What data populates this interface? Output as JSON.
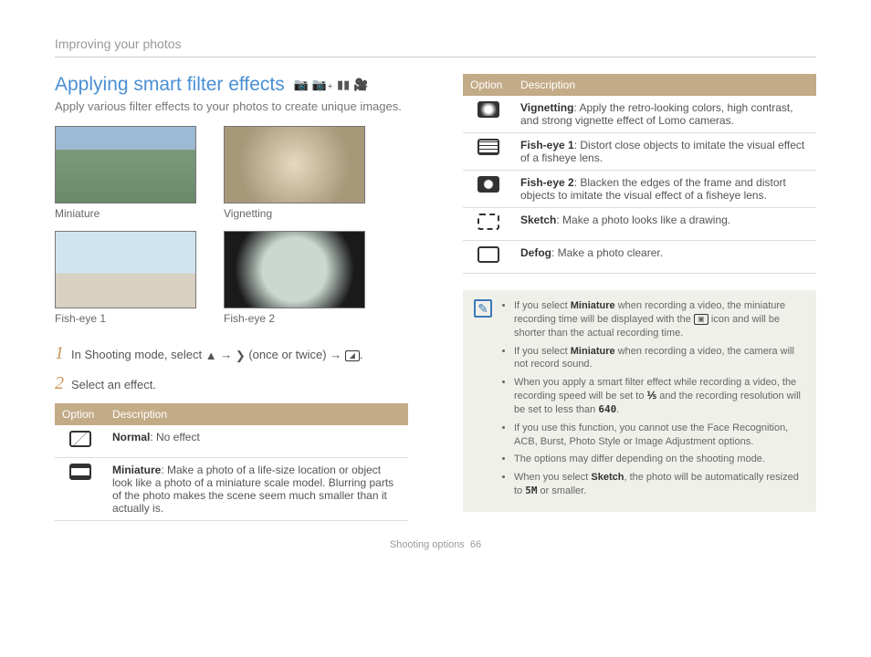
{
  "breadcrumb": "Improving your photos",
  "title": "Applying smart filter effects",
  "subtitle": "Apply various filter effects to your photos to create unique images.",
  "thumbs": {
    "t1": "Miniature",
    "t2": "Vignetting",
    "t3": "Fish-eye 1",
    "t4": "Fish-eye 2"
  },
  "steps": {
    "s1_prefix": "In Shooting mode, select ",
    "s1_mid": " (once or twice) → ",
    "s2": "Select an effect."
  },
  "table1": {
    "h1": "Option",
    "h2": "Description",
    "rows": {
      "r1_name": "Normal",
      "r1_desc": ": No effect",
      "r2_name": "Miniature",
      "r2_desc": ": Make a photo of a life-size location or object look like a photo of a miniature scale model. Blurring parts of the photo makes the scene seem much smaller than it actually is."
    }
  },
  "table2": {
    "h1": "Option",
    "h2": "Description",
    "rows": {
      "r1_name": "Vignetting",
      "r1_desc": ": Apply the retro-looking colors, high contrast, and strong vignette effect of Lomo cameras.",
      "r2_name": "Fish-eye 1",
      "r2_desc": ": Distort close objects to imitate the visual effect of a fisheye lens.",
      "r3_name": "Fish-eye 2",
      "r3_desc": ": Blacken the edges of the frame and distort objects to imitate the visual effect of a fisheye lens.",
      "r4_name": "Sketch",
      "r4_desc": ": Make a photo looks like a drawing.",
      "r5_name": "Defog",
      "r5_desc": ": Make a photo clearer."
    }
  },
  "notes": {
    "n1a": "If you select ",
    "n1b": "Miniature",
    "n1c": " when recording a video, the miniature recording time will be displayed with the ",
    "n1d": " icon and will be shorter than the actual recording time.",
    "n2a": "If you select ",
    "n2b": "Miniature",
    "n2c": " when recording a video, the camera will not record sound.",
    "n3a": "When you apply a smart filter effect while recording a video, the recording speed will be set to ",
    "n3b": " and the recording resolution will be set to less than ",
    "n3c": ".",
    "n3_speed": "⅕",
    "n3_res": "640",
    "n4": "If you use this function, you cannot use the Face Recognition, ACB, Burst, Photo Style or Image Adjustment options.",
    "n5": "The options may differ depending on the shooting mode.",
    "n6a": "When you select ",
    "n6b": "Sketch",
    "n6c": ", the photo will be automatically resized to ",
    "n6d": " or smaller.",
    "n6_size": "5M"
  },
  "footer_text": "Shooting options",
  "page_num": "66"
}
